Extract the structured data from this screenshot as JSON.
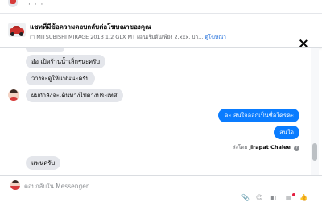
{
  "header": {
    "title": "แชทที่มีข้อความตอบกลับต่อโฆษณาของคุณ",
    "subtitle_prefix": "MITSUBISHI MIRAGE 2013 1.2 GLX MT",
    "subtitle_rest": " ผ่อนเริ่มต้นเพียง 2,xxx. บา...",
    "subtitle_link": "ดูโฆษณา"
  },
  "messages": [
    {
      "side": "in",
      "text": "อ๋อ เปิดร้านน้ำเล็กๆนะครับ"
    },
    {
      "side": "in",
      "text": "ว่างจะดูให้แฟนนะครับ"
    },
    {
      "side": "in",
      "text": "ผมกำลังจะเดินทางไปต่างประเทศ"
    },
    {
      "side": "out",
      "text": "ค่ะ สนใจออกเป็นชื่อใครคะ"
    },
    {
      "side": "out",
      "text": "สนใจ"
    },
    {
      "side": "in",
      "text": "แฟนครับ"
    }
  ],
  "sent_by": {
    "prefix": "ส่งโดย",
    "name": "Jirapat Chalee"
  },
  "composer": {
    "placeholder": "ตอบกลับใน Messenger..."
  },
  "colors": {
    "outgoing": "#0a7cff",
    "incoming": "#e4e6eb",
    "link": "#216fdb"
  },
  "icons": [
    "close-icon",
    "help-icon",
    "attach-icon",
    "emoji-icon",
    "sticker-icon",
    "gif-icon",
    "like-icon"
  ]
}
